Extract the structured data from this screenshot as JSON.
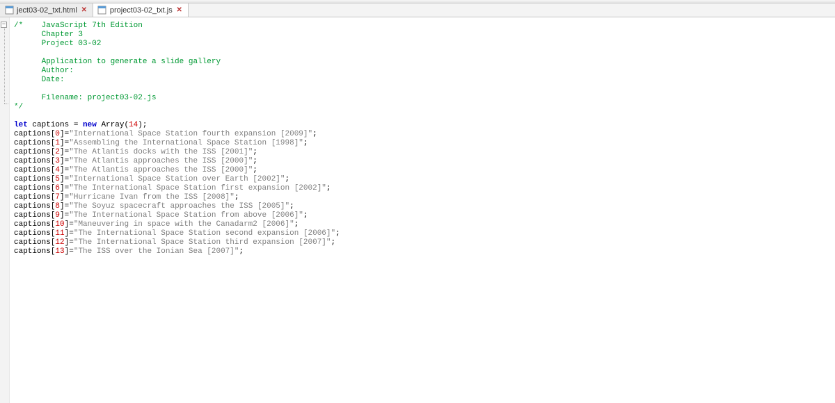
{
  "tabs": [
    {
      "label": "ject03-02_txt.html",
      "active": false
    },
    {
      "label": "project03-02_txt.js",
      "active": true
    }
  ],
  "comment": {
    "open": "/*",
    "lines": [
      "JavaScript 7th Edition",
      "Chapter 3",
      "Project 03-02",
      "",
      "Application to generate a slide gallery",
      "Author:",
      "Date:",
      "",
      "Filename: project03-02.js"
    ],
    "close": "*/"
  },
  "decl": {
    "let": "let",
    "var": "captions",
    "eq": " = ",
    "new": "new",
    "arr": " Array",
    "paren_open": "(",
    "size": "14",
    "paren_close": ")",
    "semi": ";"
  },
  "assignments": [
    {
      "idx": "0",
      "str": "\"International Space Station fourth expansion [2009]\""
    },
    {
      "idx": "1",
      "str": "\"Assembling the International Space Station [1998]\""
    },
    {
      "idx": "2",
      "str": "\"The Atlantis docks with the ISS [2001]\""
    },
    {
      "idx": "3",
      "str": "\"The Atlantis approaches the ISS [2000]\""
    },
    {
      "idx": "4",
      "str": "\"The Atlantis approaches the ISS [2000]\""
    },
    {
      "idx": "5",
      "str": "\"International Space Station over Earth [2002]\""
    },
    {
      "idx": "6",
      "str": "\"The International Space Station first expansion [2002]\""
    },
    {
      "idx": "7",
      "str": "\"Hurricane Ivan from the ISS [2008]\""
    },
    {
      "idx": "8",
      "str": "\"The Soyuz spacecraft approaches the ISS [2005]\""
    },
    {
      "idx": "9",
      "str": "\"The International Space Station from above [2006]\""
    },
    {
      "idx": "10",
      "str": "\"Maneuvering in space with the Canadarm2 [2006]\""
    },
    {
      "idx": "11",
      "str": "\"The International Space Station second expansion [2006]\""
    },
    {
      "idx": "12",
      "str": "\"The International Space Station third expansion [2007]\""
    },
    {
      "idx": "13",
      "str": "\"The ISS over the Ionian Sea [2007]\""
    }
  ],
  "assign_tokens": {
    "var": "captions",
    "br_open": "[",
    "br_close": "]",
    "eq": "=",
    "semi": ";"
  }
}
